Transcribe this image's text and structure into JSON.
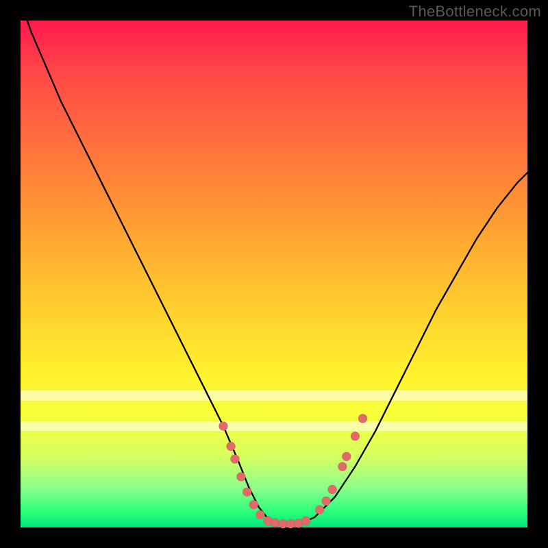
{
  "watermark": "TheBottleneck.com",
  "colors": {
    "frame": "#000000",
    "gradient_top": "#ff1a4d",
    "gradient_bottom": "#00e57a",
    "curve": "#000000",
    "dots": "#e46a6a",
    "stripe": "rgba(255,255,255,0.55)"
  },
  "chart_data": {
    "type": "line",
    "title": "",
    "xlabel": "",
    "ylabel": "",
    "xlim": [
      0,
      100
    ],
    "ylim": [
      0,
      100
    ],
    "series": [
      {
        "name": "curve",
        "x": [
          0,
          2,
          5,
          8,
          12,
          16,
          20,
          24,
          28,
          32,
          36,
          40,
          43,
          45,
          47,
          49,
          51,
          53,
          55,
          58,
          62,
          66,
          70,
          74,
          78,
          82,
          86,
          90,
          94,
          98,
          100
        ],
        "y": [
          104,
          98,
          91,
          84,
          76,
          68,
          60,
          52,
          44,
          36,
          28,
          20,
          13,
          8,
          4,
          1.5,
          0.8,
          0.6,
          0.7,
          2,
          6,
          12,
          19,
          27,
          35,
          43,
          50,
          57,
          63,
          68,
          70
        ]
      }
    ],
    "highlight_stripes_y": [
      [
        19,
        21
      ],
      [
        25,
        27
      ]
    ],
    "dots": [
      {
        "x": 40.0,
        "y": 20.0
      },
      {
        "x": 41.5,
        "y": 16.0
      },
      {
        "x": 42.3,
        "y": 13.5
      },
      {
        "x": 43.5,
        "y": 10.0
      },
      {
        "x": 44.7,
        "y": 7.0
      },
      {
        "x": 46.0,
        "y": 4.5
      },
      {
        "x": 47.3,
        "y": 2.5
      },
      {
        "x": 48.8,
        "y": 1.3
      },
      {
        "x": 50.2,
        "y": 0.9
      },
      {
        "x": 51.8,
        "y": 0.7
      },
      {
        "x": 53.3,
        "y": 0.7
      },
      {
        "x": 54.8,
        "y": 0.8
      },
      {
        "x": 56.3,
        "y": 1.3
      },
      {
        "x": 59.0,
        "y": 3.5
      },
      {
        "x": 60.3,
        "y": 5.2
      },
      {
        "x": 61.5,
        "y": 7.5
      },
      {
        "x": 63.5,
        "y": 12.0
      },
      {
        "x": 64.3,
        "y": 14.0
      },
      {
        "x": 66.0,
        "y": 18.0
      },
      {
        "x": 67.5,
        "y": 21.5
      }
    ]
  }
}
